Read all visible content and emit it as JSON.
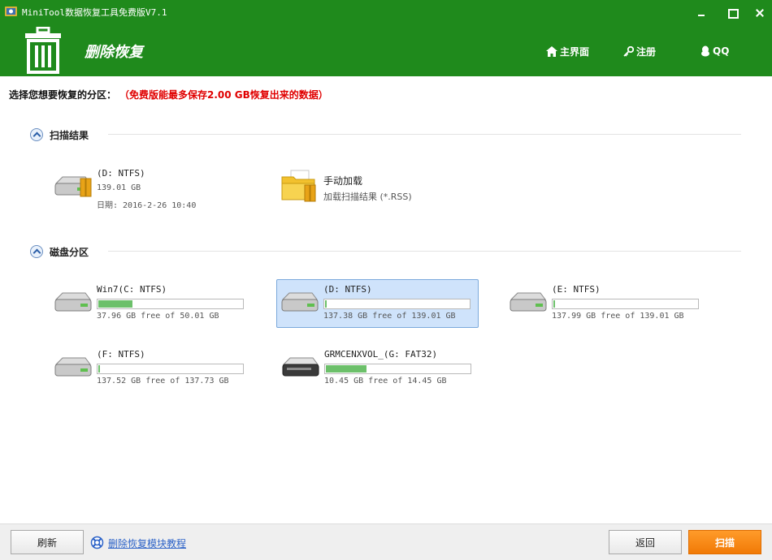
{
  "window": {
    "title": "MiniTool数据恢复工具免费版V7.1"
  },
  "header": {
    "module_title": "删除恢复",
    "nav": {
      "home": "主界面",
      "register": "注册",
      "qq": "QQ"
    }
  },
  "prompt": {
    "label": "选择您想要恢复的分区：",
    "warning": "（免费版能最多保存2.00 GB恢复出来的数据）"
  },
  "scan_results": {
    "title": "扫描结果",
    "drive": {
      "name": "(D: NTFS)",
      "size": "139.01 GB",
      "date": "日期: 2016-2-26 10:40"
    },
    "manual": {
      "name": "手动加载",
      "sub": "加载扫描结果 (*.RSS)"
    }
  },
  "partitions": {
    "title": "磁盘分区",
    "items": [
      {
        "name": "Win7(C: NTFS)",
        "free": "37.96 GB free of 50.01 GB",
        "used_fraction": 0.24
      },
      {
        "name": "(D: NTFS)",
        "free": "137.38 GB free of 139.01 GB",
        "used_fraction": 0.012
      },
      {
        "name": "(E: NTFS)",
        "free": "137.99 GB free of 139.01 GB",
        "used_fraction": 0.007
      },
      {
        "name": "(F: NTFS)",
        "free": "137.52 GB free of 137.73 GB",
        "used_fraction": 0.0
      },
      {
        "name": "GRMCENXVOL_(G: FAT32)",
        "free": "10.45 GB free of 14.45 GB",
        "used_fraction": 0.28
      }
    ]
  },
  "footer": {
    "refresh": "刷新",
    "help_link": "删除恢复模块教程",
    "back": "返回",
    "scan": "扫描"
  },
  "colors": {
    "header": "#1f8a1c",
    "bar_fill": "#6cc06a",
    "warning": "#e00000",
    "scan_button": "#f58a14",
    "selected": "#cfe3fb"
  }
}
